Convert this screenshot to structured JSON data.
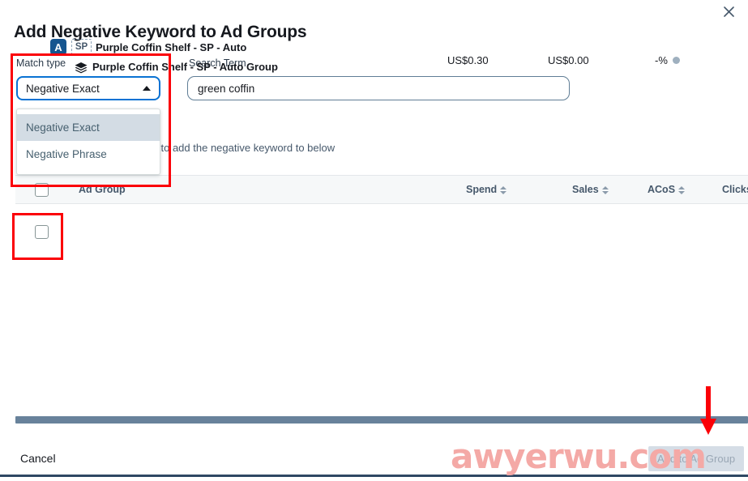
{
  "modal": {
    "title": "Add Negative Keyword to Ad Groups",
    "close_icon": "close-icon"
  },
  "form": {
    "match_type": {
      "label": "Match type",
      "value": "Negative Exact",
      "expanded": true,
      "chevron_icon": "chevron-up-icon",
      "options": [
        {
          "label": "Negative Exact",
          "selected": true
        },
        {
          "label": "Negative Phrase",
          "selected": false
        }
      ]
    },
    "search_term": {
      "label": "Search Term",
      "value": "green coffin",
      "placeholder": "Search Term"
    }
  },
  "helper_text": "Select the ad groups you want to add the negative keyword to below",
  "table": {
    "select_all_checkbox": false,
    "columns": [
      {
        "key": "ad_group",
        "label": "Ad Group",
        "sortable": false
      },
      {
        "key": "spend",
        "label": "Spend",
        "sortable": true
      },
      {
        "key": "sales",
        "label": "Sales",
        "sortable": true
      },
      {
        "key": "acos",
        "label": "ACoS",
        "sortable": true
      },
      {
        "key": "clicks",
        "label": "Clicks",
        "sortable": true
      }
    ],
    "rows": [
      {
        "checked": false,
        "badge_platform": "A",
        "badge_type": "SP",
        "campaign": "Purple Coffin Shelf - SP - Auto",
        "ad_group": "Purple Coffin Shelf - SP - Auto Group",
        "ad_group_icon": "layers-stack-icon",
        "spend": "US$0.30",
        "sales": "US$0.00",
        "acos": "-%"
      }
    ]
  },
  "footer": {
    "cancel_label": "Cancel",
    "submit_label": "Add to Ad Group",
    "submit_disabled": true
  },
  "annotations": {
    "arrow_icon": "red-down-arrow",
    "watermark": "awyerwu.com"
  },
  "colors": {
    "accent_blue": "#0972d3",
    "badge_blue": "#16558f",
    "annotation_red": "#fb0007",
    "scrollbar": "#68829b",
    "watermark": "#f4a9a6"
  }
}
